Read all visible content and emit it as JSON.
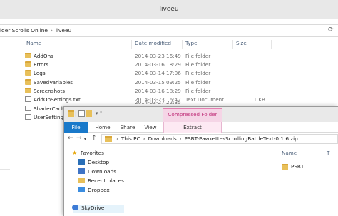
{
  "back_window": {
    "title": "liveeu",
    "address": [
      "lder Scrolls Online",
      "liveeu"
    ],
    "columns": {
      "name": "Name",
      "date_modified": "Date modified",
      "type": "Type",
      "size": "Size"
    },
    "rows": [
      {
        "name": "AddOns",
        "date": "2014-03-23 16:49",
        "type": "File folder",
        "size": "",
        "icon": "folder-icon"
      },
      {
        "name": "Errors",
        "date": "2014-03-16 18:29",
        "type": "File folder",
        "size": "",
        "icon": "folder-icon"
      },
      {
        "name": "Logs",
        "date": "2014-03-14 17:06",
        "type": "File folder",
        "size": "",
        "icon": "folder-icon"
      },
      {
        "name": "SavedVariables",
        "date": "2014-03-15 09:25",
        "type": "File folder",
        "size": "",
        "icon": "folder-icon"
      },
      {
        "name": "Screenshots",
        "date": "2014-03-16 18:29",
        "type": "File folder",
        "size": "",
        "icon": "folder-icon"
      },
      {
        "name": "AddOnSettings.txt",
        "date": "2014-03-23 16:42",
        "type": "Text Document",
        "size": "1 KB",
        "icon": "document-icon"
      },
      {
        "name": "ShaderCache",
        "date": "",
        "type": "",
        "size": "",
        "icon": "document-icon"
      },
      {
        "name": "UserSettings.t",
        "date": "2014-03-27 22:35",
        "type": "",
        "size": "",
        "icon": "document-icon"
      }
    ]
  },
  "front_window": {
    "contextual_tab_group": "Compressed Folder Tools",
    "ribbon_tabs": {
      "file": "File",
      "home": "Home",
      "share": "Share",
      "view": "View",
      "extract": "Extract"
    },
    "address": [
      "This PC",
      "Downloads",
      "PSBT-PawkettesScrollingBattleText-0.1.6.zip"
    ],
    "nav": {
      "favorites": "Favorites",
      "desktop": "Desktop",
      "downloads": "Downloads",
      "recent_places": "Recent places",
      "dropbox": "Dropbox",
      "skydrive": "SkyDrive"
    },
    "columns": {
      "name": "Name",
      "type": "T"
    },
    "items": [
      {
        "name": "PSBT",
        "icon": "folder-icon"
      }
    ]
  },
  "colors": {
    "file_tab": "#1979ca",
    "contextual_tab": "#c2347c",
    "folder": "#e8c05a"
  }
}
